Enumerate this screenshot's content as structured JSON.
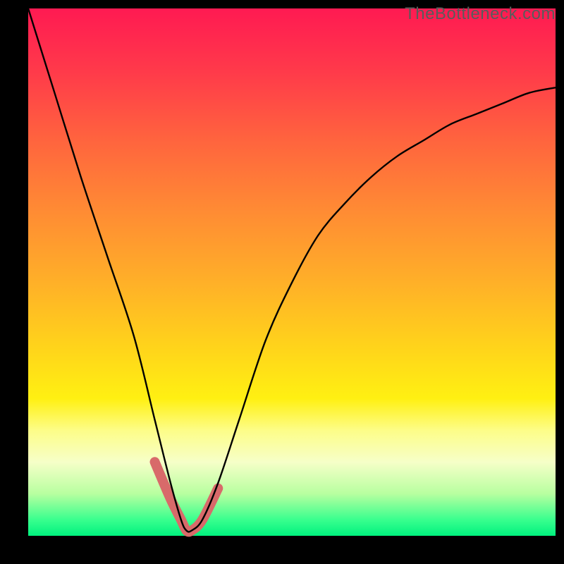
{
  "watermark": "TheBottleneck.com",
  "chart_data": {
    "type": "line",
    "title": "",
    "xlabel": "",
    "ylabel": "",
    "xlim": [
      0,
      100
    ],
    "ylim": [
      0,
      100
    ],
    "grid": false,
    "series": [
      {
        "name": "bottleneck-curve",
        "x": [
          0,
          5,
          10,
          15,
          20,
          24,
          27,
          29,
          30,
          31,
          33,
          36,
          40,
          45,
          50,
          55,
          60,
          65,
          70,
          75,
          80,
          85,
          90,
          95,
          100
        ],
        "values": [
          100,
          84,
          68,
          53,
          38,
          22,
          10,
          3,
          1,
          1,
          3,
          10,
          22,
          37,
          48,
          57,
          63,
          68,
          72,
          75,
          78,
          80,
          82,
          84,
          85
        ]
      },
      {
        "name": "highlight-band",
        "x": [
          24,
          27,
          29,
          30,
          31,
          33,
          36
        ],
        "values": [
          14,
          7,
          3,
          1,
          1,
          3,
          9
        ]
      }
    ],
    "annotations": []
  },
  "colors": {
    "curve": "#000000",
    "highlight": "#d86a6a"
  }
}
